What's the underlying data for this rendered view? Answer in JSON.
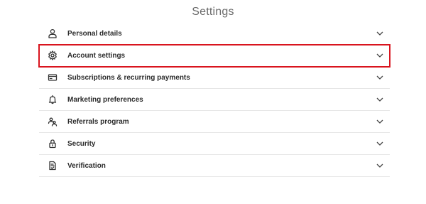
{
  "page": {
    "title": "Settings"
  },
  "settings": {
    "items": [
      {
        "label": "Personal details",
        "icon": "person-icon"
      },
      {
        "label": "Account settings",
        "icon": "gear-icon"
      },
      {
        "label": "Subscriptions & recurring payments",
        "icon": "card-icon"
      },
      {
        "label": "Marketing preferences",
        "icon": "bell-icon"
      },
      {
        "label": "Referrals program",
        "icon": "people-icon"
      },
      {
        "label": "Security",
        "icon": "lock-icon"
      },
      {
        "label": "Verification",
        "icon": "document-check-icon"
      }
    ]
  },
  "colors": {
    "highlight": "#d9141e",
    "divider": "#e6e6e6"
  }
}
